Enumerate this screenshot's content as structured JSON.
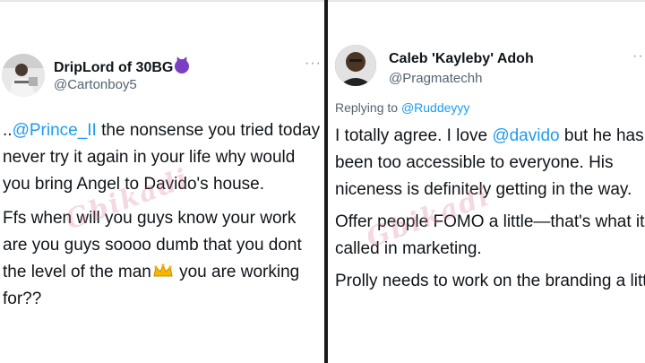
{
  "left_tweet": {
    "display_name": "DripLord of 30BG",
    "handle": "@Cartonboy5",
    "more_icon": "more-icon",
    "paragraphs": [
      {
        "prefix": "..",
        "mention": "@Prince_II",
        "text": " the nonsense you tried today never try it again in your life why would you bring Angel to Davido's house."
      },
      {
        "before_emoji": "Ffs when will you guys know your work are you guys soooo dumb that you dont the level of the man",
        "emoji": "crown-icon",
        "after_emoji": " you are working for??"
      }
    ]
  },
  "right_tweet": {
    "display_name": "Caleb 'Kayleby' Adoh",
    "handle": "@Pragmatechh",
    "more_icon": "more-icon",
    "replying_prefix": "Replying to ",
    "replying_to": "@Ruddeyyy",
    "p1_before": "I totally agree. I love ",
    "p1_mention": "@davido",
    "p1_after": " but he has been too accessible to everyone. His niceness is definitely getting in the way.",
    "p2": "Offer people FOMO a little—that's what it's called in marketing.",
    "p3": "Prolly needs to work on the branding a little."
  },
  "watermark": "Gbikadi",
  "colors": {
    "mention": "#1d9bf0",
    "secondary_text": "#536471",
    "divider": "#1a1a1a"
  }
}
